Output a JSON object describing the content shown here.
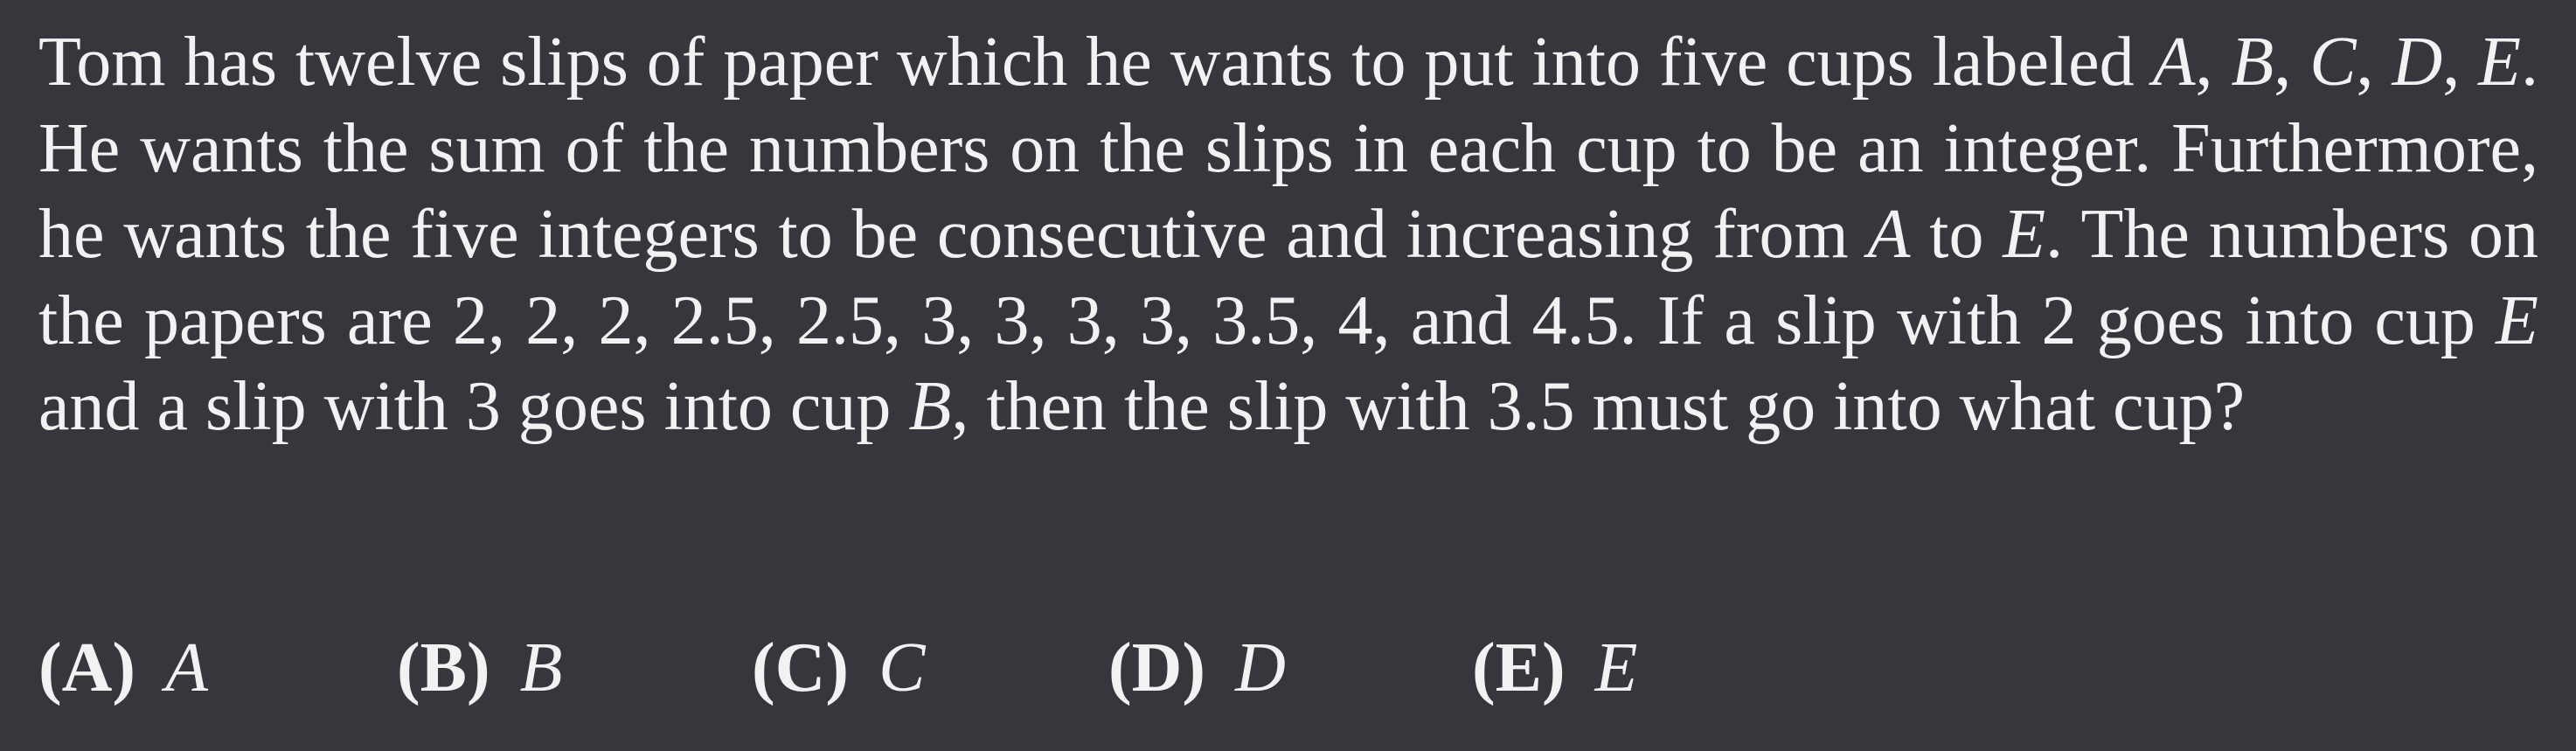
{
  "problem": {
    "t1": "Tom has twelve slips of paper which he wants to put into five cups labeled ",
    "A": "A",
    "c1": ", ",
    "B": "B",
    "c2": ", ",
    "C": "C",
    "c3": ", ",
    "D": "D",
    "c4": ", ",
    "E": "E",
    "t2": ".  He wants the sum of the numbers on the slips in each cup to be an integer.  Furthermore, he wants the five integers to be consecutive and increasing from ",
    "A2": "A",
    "t3": " to ",
    "E2": "E",
    "t4": ".  The numbers on the papers are 2, 2, 2, 2.5, 2.5, 3, 3, 3, 3, 3.5, 4, and 4.5. If a slip with 2 goes into cup ",
    "E3": "E",
    "t5": " and a slip with 3 goes into cup ",
    "B2": "B",
    "t6": ", then the slip with 3.5 must go into what cup?"
  },
  "choices": [
    {
      "label": "(A)",
      "value": "A"
    },
    {
      "label": "(B)",
      "value": "B"
    },
    {
      "label": "(C)",
      "value": "C"
    },
    {
      "label": "(D)",
      "value": "D"
    },
    {
      "label": "(E)",
      "value": "E"
    }
  ]
}
